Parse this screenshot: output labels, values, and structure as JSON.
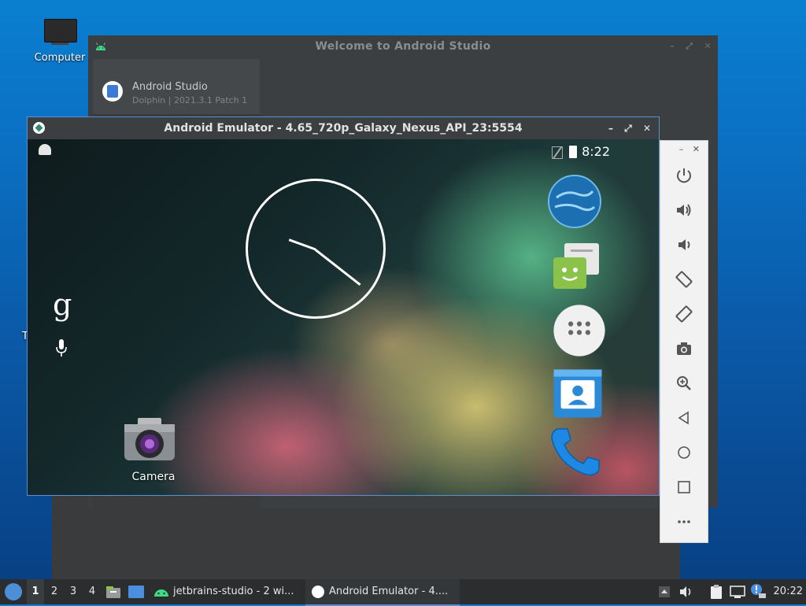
{
  "desktop": {
    "computer_label": "Computer",
    "stray_letter": "T"
  },
  "studio": {
    "title": "Welcome to Android Studio",
    "project_name": "Android Studio",
    "project_version": "Dolphin | 2021.3.1 Patch 1",
    "ctrls": [
      "–",
      "⤢",
      "✕"
    ]
  },
  "emulator": {
    "title": "Android Emulator - 4.65_720p_Galaxy_Nexus_API_23:5554",
    "ctrls": [
      "–",
      "⤢",
      "✕"
    ],
    "status_time": "8:22",
    "google_letter": "g",
    "camera_label": "Camera"
  },
  "panel": {
    "ctrls": [
      "–",
      "✕"
    ],
    "buttons": [
      "power-icon",
      "volume-up-icon",
      "volume-down-icon",
      "rotate-left-icon",
      "rotate-right-icon",
      "camera-icon",
      "zoom-icon",
      "back-icon",
      "home-icon",
      "overview-icon",
      "more-icon"
    ]
  },
  "taskbar": {
    "workspaces": [
      "1",
      "2",
      "3",
      "4"
    ],
    "tasks": [
      "jetbrains-studio - 2 wi...",
      "Android Emulator - 4...."
    ],
    "clock": "20:22"
  }
}
